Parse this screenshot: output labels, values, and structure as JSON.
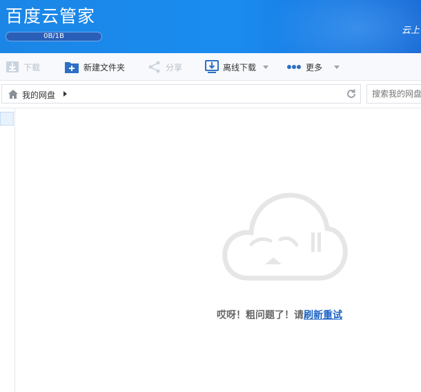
{
  "app": {
    "title": "百度云管家",
    "quota": "0B/1B",
    "slogan": "云上"
  },
  "toolbar": {
    "download_label": "下载",
    "new_folder_label": "新建文件夹",
    "share_label": "分享",
    "offline_download_label": "离线下载",
    "more_label": "更多"
  },
  "address": {
    "breadcrumb_label": "我的网盘",
    "search_placeholder": "搜索我的网盘"
  },
  "error": {
    "message": "哎呀！粗问题了！请",
    "retry_link": "刷新重试"
  },
  "colors": {
    "header_blue": "#1a8cf0",
    "link_blue": "#1b62c4"
  }
}
